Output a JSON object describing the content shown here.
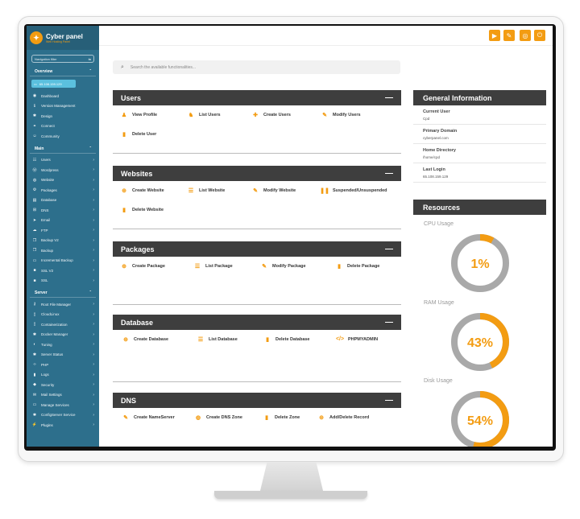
{
  "brand": {
    "name": "Cyber panel",
    "tagline": "Web Hosting Panel"
  },
  "sidebar": {
    "filter_placeholder": "Navigation filter",
    "overview_title": "Overview",
    "ip": "65.108.159.129",
    "overview_items": [
      {
        "label": "Dashboard",
        "icon": "dashboard-icon",
        "glyph": "◉"
      },
      {
        "label": "Version Management",
        "icon": "info-icon",
        "glyph": "ℹ"
      },
      {
        "label": "Design",
        "icon": "gear-icon",
        "glyph": "✱"
      },
      {
        "label": "Connect",
        "icon": "link-icon",
        "glyph": "⚭"
      },
      {
        "label": "Community",
        "icon": "chat-icon",
        "glyph": "☺"
      }
    ],
    "main_title": "Main",
    "main_items": [
      {
        "label": "Users",
        "icon": "users-icon",
        "glyph": "☷"
      },
      {
        "label": "Wordpress",
        "icon": "wordpress-icon",
        "glyph": "Ⓦ"
      },
      {
        "label": "Website",
        "icon": "globe-icon",
        "glyph": "◍"
      },
      {
        "label": "Packages",
        "icon": "packages-icon",
        "glyph": "⚙"
      },
      {
        "label": "Database",
        "icon": "database-icon",
        "glyph": "▤"
      },
      {
        "label": "DNS",
        "icon": "dns-icon",
        "glyph": "⊞"
      },
      {
        "label": "Email",
        "icon": "paper-plane-icon",
        "glyph": "➤"
      },
      {
        "label": "FTP",
        "icon": "cloud-icon",
        "glyph": "☁"
      },
      {
        "label": "Backup V2",
        "icon": "copy-icon",
        "glyph": "❐"
      },
      {
        "label": "Backup",
        "icon": "copy-icon",
        "glyph": "❐"
      },
      {
        "label": "Incremental Backup",
        "icon": "window-icon",
        "glyph": "▭"
      },
      {
        "label": "SSL V2",
        "icon": "lock-icon",
        "glyph": "■"
      },
      {
        "label": "SSL",
        "icon": "lock-icon",
        "glyph": "■"
      }
    ],
    "server_title": "Server",
    "server_items": [
      {
        "label": "Root File Manager",
        "icon": "key-icon",
        "glyph": "⚷"
      },
      {
        "label": "CloudLinux",
        "icon": "file-icon",
        "glyph": "▯"
      },
      {
        "label": "Containerization",
        "icon": "file-icon",
        "glyph": "▯"
      },
      {
        "label": "Docker Manager",
        "icon": "gear-icon",
        "glyph": "✱"
      },
      {
        "label": "Tuning",
        "icon": "adjust-icon",
        "glyph": "◐"
      },
      {
        "label": "Server Status",
        "icon": "gear-icon",
        "glyph": "✱"
      },
      {
        "label": "PHP",
        "icon": "code-icon",
        "glyph": "‹›"
      },
      {
        "label": "Logs",
        "icon": "file-icon",
        "glyph": "▮"
      },
      {
        "label": "Security",
        "icon": "shield-icon",
        "glyph": "◆"
      },
      {
        "label": "Mail Settings",
        "icon": "mail-icon",
        "glyph": "✉"
      },
      {
        "label": "Manage Services",
        "icon": "window-icon",
        "glyph": "▭"
      },
      {
        "label": "ConfigServer Service",
        "icon": "gear-icon",
        "glyph": "✱"
      },
      {
        "label": "Plugins",
        "icon": "plug-icon",
        "glyph": "⚡"
      }
    ]
  },
  "header": {
    "buttons": [
      {
        "icon": "youtube-icon",
        "glyph": "▶"
      },
      {
        "icon": "chat-icon",
        "glyph": "✎"
      },
      {
        "icon": "help-icon",
        "glyph": "◎"
      },
      {
        "icon": "power-icon",
        "glyph": "⏻"
      }
    ]
  },
  "search": {
    "placeholder": "Search the available functionalities..."
  },
  "panels": {
    "users": {
      "title": "Users",
      "minimize": "—",
      "actions": [
        {
          "label": "View Profile",
          "glyph": "♟",
          "icon": "user-icon"
        },
        {
          "label": "List Users",
          "glyph": "♞",
          "icon": "users-list-icon"
        },
        {
          "label": "Create Users",
          "glyph": "✚",
          "icon": "user-plus-icon"
        },
        {
          "label": "Modify Users",
          "glyph": "✎",
          "icon": "user-edit-icon"
        },
        {
          "label": "Delete User",
          "glyph": "▮",
          "icon": "trash-icon"
        }
      ]
    },
    "websites": {
      "title": "Websites",
      "minimize": "—",
      "actions": [
        {
          "label": "Create Website",
          "glyph": "⊕",
          "icon": "plus-circle-icon"
        },
        {
          "label": "List Website",
          "glyph": "☰",
          "icon": "list-icon"
        },
        {
          "label": "Modify Website",
          "glyph": "✎",
          "icon": "edit-icon"
        },
        {
          "label": "Suspended/Unsuspended",
          "glyph": "❚❚",
          "icon": "pause-icon"
        },
        {
          "label": "Delete Website",
          "glyph": "▮",
          "icon": "trash-icon"
        }
      ]
    },
    "packages": {
      "title": "Packages",
      "minimize": "—",
      "actions": [
        {
          "label": "Create Package",
          "glyph": "⊕",
          "icon": "plus-circle-icon"
        },
        {
          "label": "List Package",
          "glyph": "☰",
          "icon": "list-icon"
        },
        {
          "label": "Modify Package",
          "glyph": "✎",
          "icon": "edit-icon"
        },
        {
          "label": "Delete Package",
          "glyph": "▮",
          "icon": "trash-icon"
        }
      ]
    },
    "database": {
      "title": "Database",
      "minimize": "—",
      "actions": [
        {
          "label": "Create Database",
          "glyph": "⊕",
          "icon": "plus-circle-icon"
        },
        {
          "label": "List Database",
          "glyph": "☰",
          "icon": "list-icon"
        },
        {
          "label": "Delete Database",
          "glyph": "▮",
          "icon": "trash-icon"
        },
        {
          "label": "PHPMYADMIN",
          "glyph": "</>",
          "icon": "code-icon"
        }
      ]
    },
    "dns": {
      "title": "DNS",
      "minimize": "—",
      "actions": [
        {
          "label": "Create NameServer",
          "glyph": "✎",
          "icon": "pencil-icon"
        },
        {
          "label": "Create DNS Zone",
          "glyph": "◍",
          "icon": "globe-icon"
        },
        {
          "label": "Delete Zone",
          "glyph": "▮",
          "icon": "trash-icon"
        },
        {
          "label": "Add/Delete Record",
          "glyph": "⊕",
          "icon": "plus-circle-icon"
        }
      ]
    }
  },
  "general_info": {
    "title": "General Information",
    "rows": [
      {
        "key": "Current User",
        "value": "Cpd"
      },
      {
        "key": "Primary Domain",
        "value": "cyberpanel.com"
      },
      {
        "key": "Home Directory",
        "value": "/home/cpd"
      },
      {
        "key": "Last Login",
        "value": "65.108.159.129"
      }
    ]
  },
  "resources": {
    "title": "Resources",
    "accent": "#f39c12",
    "track": "#a9a9a9",
    "gauges": [
      {
        "label": "CPU Usage",
        "percent": 1,
        "text": "1%"
      },
      {
        "label": "RAM Usage",
        "percent": 43,
        "text": "43%"
      },
      {
        "label": "Disk Usage",
        "percent": 54,
        "text": "54%"
      }
    ]
  }
}
